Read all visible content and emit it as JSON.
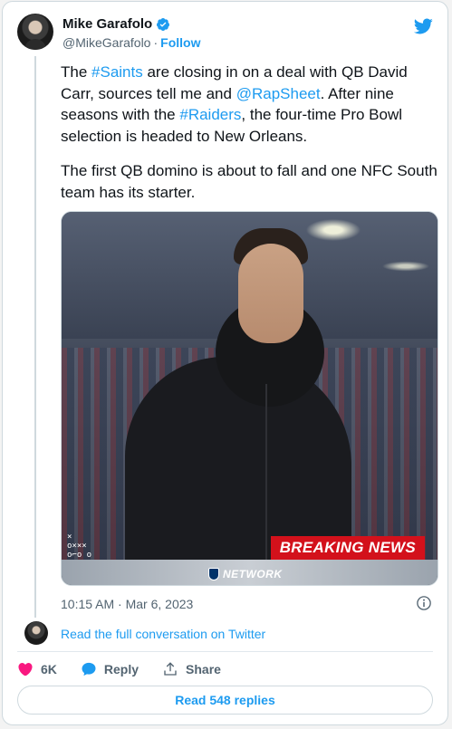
{
  "author": {
    "name": "Mike Garafolo",
    "handle": "@MikeGarafolo",
    "separator": "·",
    "follow_label": "Follow"
  },
  "tweet": {
    "p1": {
      "t1": "The ",
      "hashtag1": "#Saints",
      "t2": " are closing in on a deal with QB David Carr, sources tell me and ",
      "mention": "@RapSheet",
      "t3": ". After nine seasons with the ",
      "hashtag2": "#Raiders",
      "t4": ", the four-time Pro Bowl selection is headed to New Orleans."
    },
    "p2": "The first QB domino is about to fall and one NFC South team has its starter."
  },
  "media": {
    "banner": "BREAKING NEWS",
    "network": "NETWORK",
    "play_top": "×",
    "play_mid": "o×××",
    "play_bot": "o⌐o o"
  },
  "timestamp": "10:15 AM · Mar 6, 2023",
  "conversation_link": "Read the full conversation on Twitter",
  "actions": {
    "likes": "6K",
    "reply_label": "Reply",
    "share_label": "Share"
  },
  "replies_button": "Read 548 replies",
  "colors": {
    "link_blue": "#1d9bf0",
    "like_red": "#f91880",
    "breaking_red": "#d3111b",
    "muted": "#536471"
  },
  "icons": {
    "brand": "twitter-bird-icon",
    "verified": "verified-badge-icon",
    "info": "info-icon",
    "like": "heart-icon",
    "reply": "speech-bubble-icon",
    "share": "share-upload-icon"
  }
}
